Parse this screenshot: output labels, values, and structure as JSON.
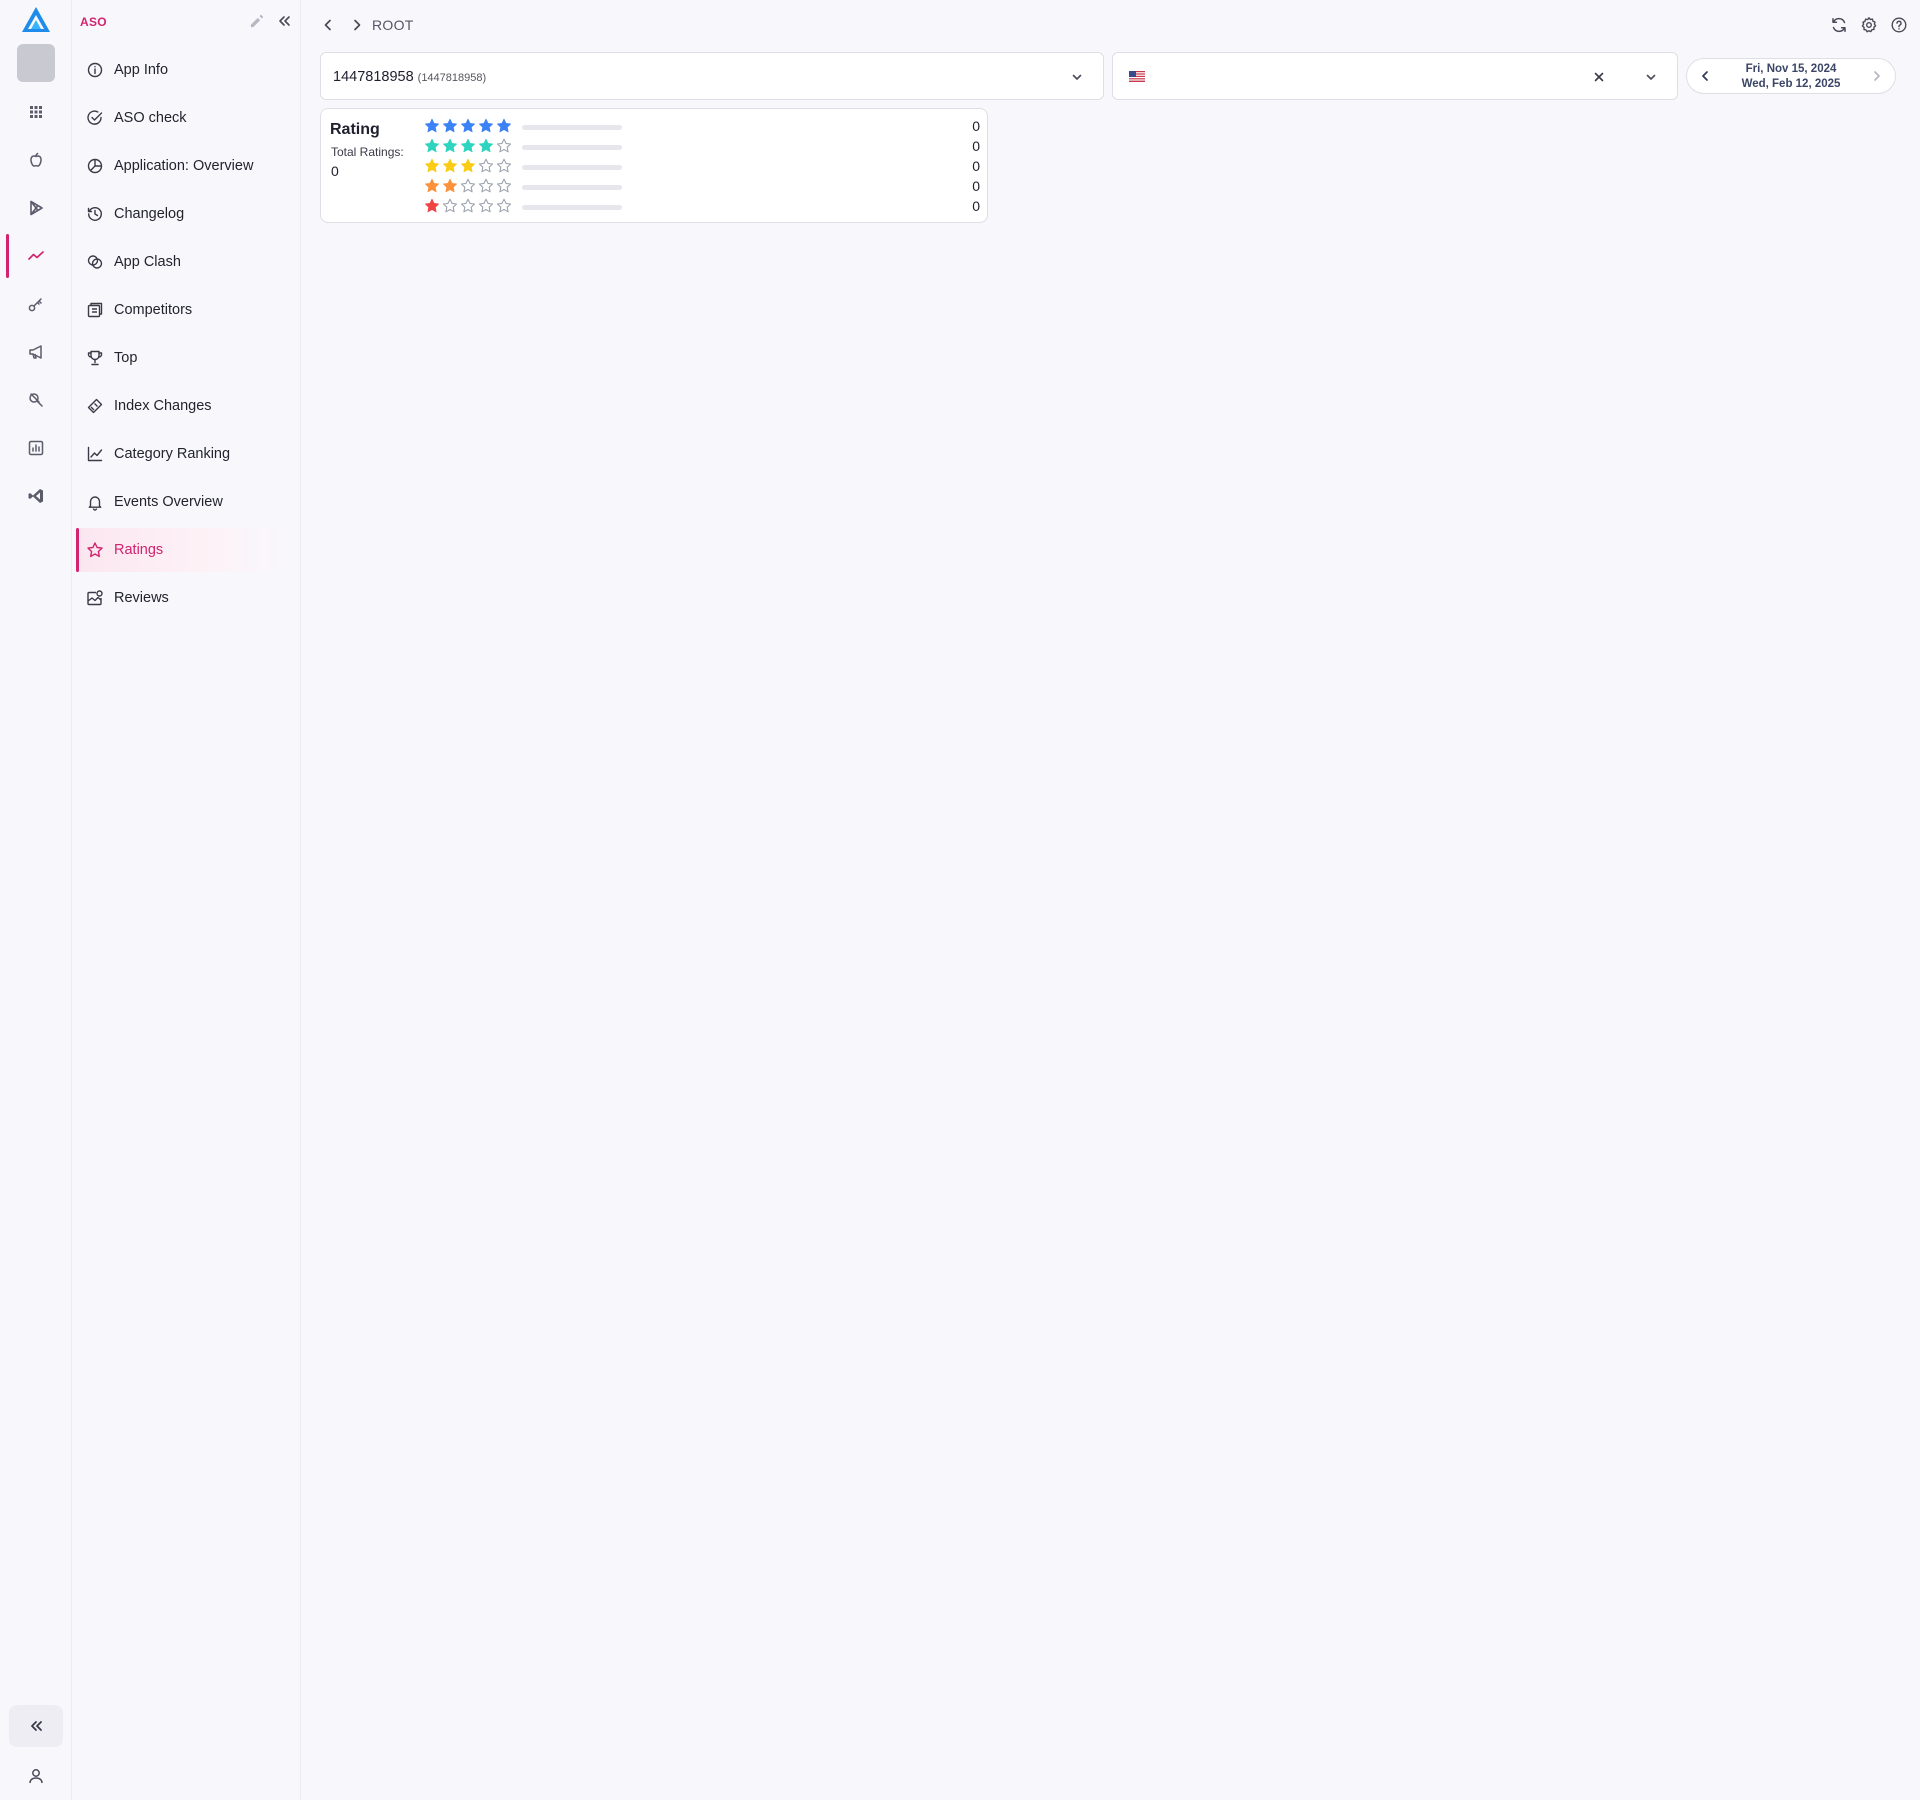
{
  "nav": {
    "title": "ASO",
    "items": [
      {
        "label": "App Info",
        "icon": "info-icon"
      },
      {
        "label": "ASO check",
        "icon": "check-circle-icon"
      },
      {
        "label": "Application: Overview",
        "icon": "pie-chart-icon"
      },
      {
        "label": "Changelog",
        "icon": "history-icon"
      },
      {
        "label": "App Clash",
        "icon": "overlap-icon"
      },
      {
        "label": "Competitors",
        "icon": "competitors-icon"
      },
      {
        "label": "Top",
        "icon": "trophy-icon"
      },
      {
        "label": "Index Changes",
        "icon": "index-changes-icon"
      },
      {
        "label": "Category Ranking",
        "icon": "line-chart-icon"
      },
      {
        "label": "Events Overview",
        "icon": "bell-icon"
      },
      {
        "label": "Ratings",
        "icon": "star-icon"
      },
      {
        "label": "Reviews",
        "icon": "reviews-icon"
      }
    ],
    "active": "Ratings"
  },
  "rail": {
    "items": [
      "apps-grid-icon",
      "apple-icon",
      "google-play-icon",
      "trend-icon",
      "key-icon",
      "megaphone-icon",
      "search-tools-icon",
      "report-icon",
      "vscode-icon"
    ],
    "active": "trend-icon"
  },
  "topbar": {
    "breadcrumb": "ROOT"
  },
  "filters": {
    "app_id": "1447818958",
    "app_id_sub": "(1447818958)",
    "country_flag": "us-flag",
    "date_from": "Fri, Nov 15, 2024",
    "date_to": "Wed, Feb 12, 2025"
  },
  "rating": {
    "title": "Rating",
    "total_label": "Total Ratings:",
    "total_value": "0",
    "rows": [
      {
        "stars": 5,
        "count": "0",
        "share": 0,
        "color": "#3b82f6"
      },
      {
        "stars": 4,
        "count": "0",
        "share": 0,
        "color": "#2dd4bf"
      },
      {
        "stars": 3,
        "count": "0",
        "share": 0,
        "color": "#facc15"
      },
      {
        "stars": 2,
        "count": "0",
        "share": 0,
        "color": "#fb923c"
      },
      {
        "stars": 1,
        "count": "0",
        "share": 0,
        "color": "#ef4444"
      }
    ]
  },
  "colors": {
    "accent": "#d1236f",
    "empty_star": "#9ca3af"
  }
}
